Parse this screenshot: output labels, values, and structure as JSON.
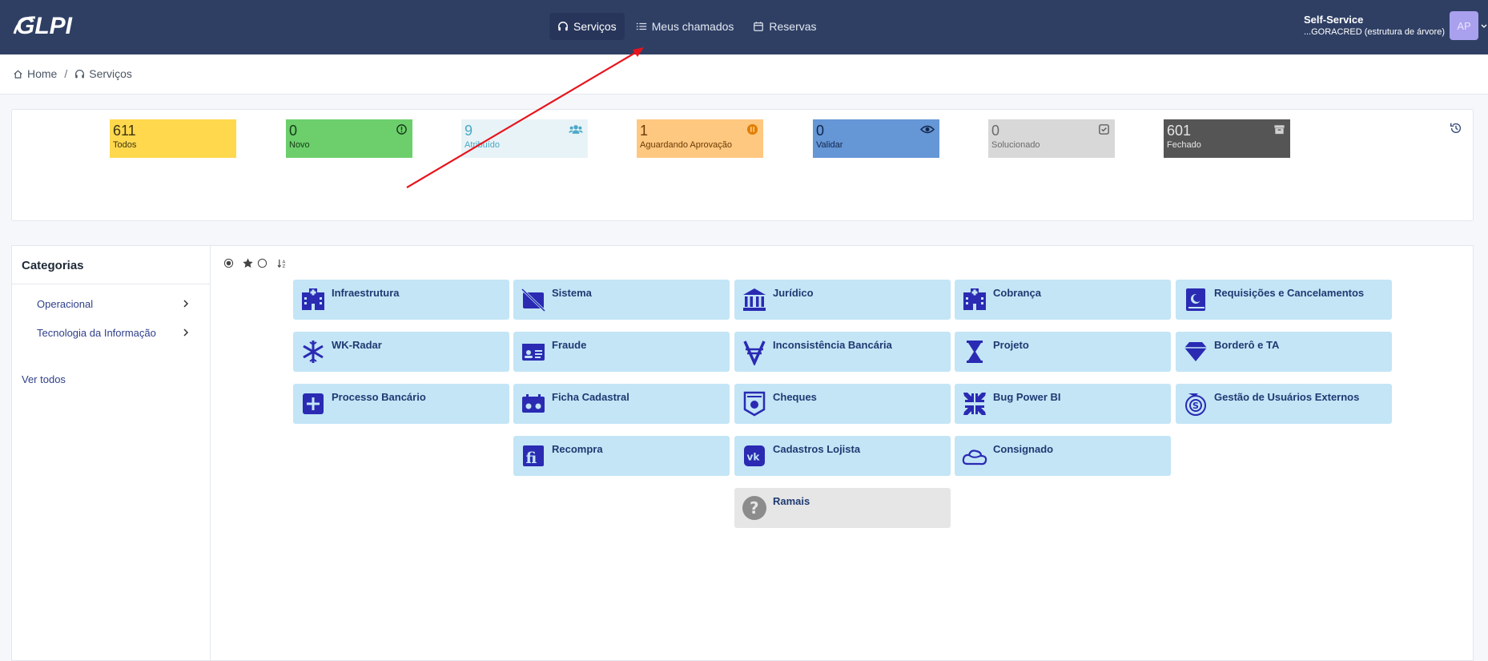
{
  "header": {
    "logo_text": "GLPI",
    "nav": [
      {
        "label": "Serviços",
        "icon": "headset-icon",
        "active": true
      },
      {
        "label": "Meus chamados",
        "icon": "list-icon",
        "active": false
      },
      {
        "label": "Reservas",
        "icon": "calendar-icon",
        "active": false
      }
    ],
    "user_profile": "Self-Service",
    "user_entity": "...GORACRED (estrutura de árvore)",
    "avatar_initials": "AP"
  },
  "breadcrumb": {
    "home": "Home",
    "current": "Serviços"
  },
  "tiles": [
    {
      "count": "611",
      "label": "Todos",
      "icon": "",
      "bg": "#ffd84d",
      "fg": "#3c3412"
    },
    {
      "count": "0",
      "label": "Novo",
      "icon": "alert-circle-icon",
      "bg": "#6ccf6c",
      "fg": "#173a17"
    },
    {
      "count": "9",
      "label": "Atribuído",
      "icon": "users-icon",
      "bg": "#e8f3f7",
      "fg": "#49a9c7"
    },
    {
      "count": "1",
      "label": "Aguardando Aprovação",
      "icon": "pause-circle-icon",
      "bg": "#ffc880",
      "fg": "#6a3a05"
    },
    {
      "count": "0",
      "label": "Validar",
      "icon": "eye-icon",
      "bg": "#6596d6",
      "fg": "#12264b"
    },
    {
      "count": "0",
      "label": "Solucionado",
      "icon": "check-square-icon",
      "bg": "#d8d8d8",
      "fg": "#6b6b6b"
    },
    {
      "count": "601",
      "label": "Fechado",
      "icon": "archive-icon",
      "bg": "#555555",
      "fg": "#e6e6e6"
    }
  ],
  "sidebar": {
    "title": "Categorias",
    "items": [
      {
        "label": "Operacional"
      },
      {
        "label": "Tecnologia da Informação"
      }
    ],
    "see_all": "Ver todos"
  },
  "categories": [
    {
      "label": "Infraestrutura",
      "icon": "hospital-icon"
    },
    {
      "label": "Sistema",
      "icon": "id-card-slash-icon"
    },
    {
      "label": "Jurídico",
      "icon": "bank-icon"
    },
    {
      "label": "Cobrança",
      "icon": "hospital-icon"
    },
    {
      "label": "Requisições e Cancelamentos",
      "icon": "quran-book-icon"
    },
    {
      "label": "WK-Radar",
      "icon": "snowflake-icon"
    },
    {
      "label": "Fraude",
      "icon": "id-card-icon"
    },
    {
      "label": "Inconsistência Bancária",
      "icon": "viacoin-icon"
    },
    {
      "label": "Projeto",
      "icon": "hourglass-icon"
    },
    {
      "label": "Borderô e TA",
      "icon": "diamond-icon"
    },
    {
      "label": "Processo Bancário",
      "icon": "plus-square-icon"
    },
    {
      "label": "Ficha Cadastral",
      "icon": "cassette-icon"
    },
    {
      "label": "Cheques",
      "icon": "money-badge-icon"
    },
    {
      "label": "Bug Power BI",
      "icon": "compress-arrows-icon"
    },
    {
      "label": "Gestão de Usuários Externos",
      "icon": "stripe-s-icon"
    },
    {
      "label": "Recompra",
      "icon": "fi-square-icon"
    },
    {
      "label": "Cadastros Lojista",
      "icon": "vk-icon"
    },
    {
      "label": "Consignado",
      "icon": "cloud-outline-icon"
    },
    {
      "label": "Ramais",
      "icon": "question-circle-icon"
    }
  ]
}
